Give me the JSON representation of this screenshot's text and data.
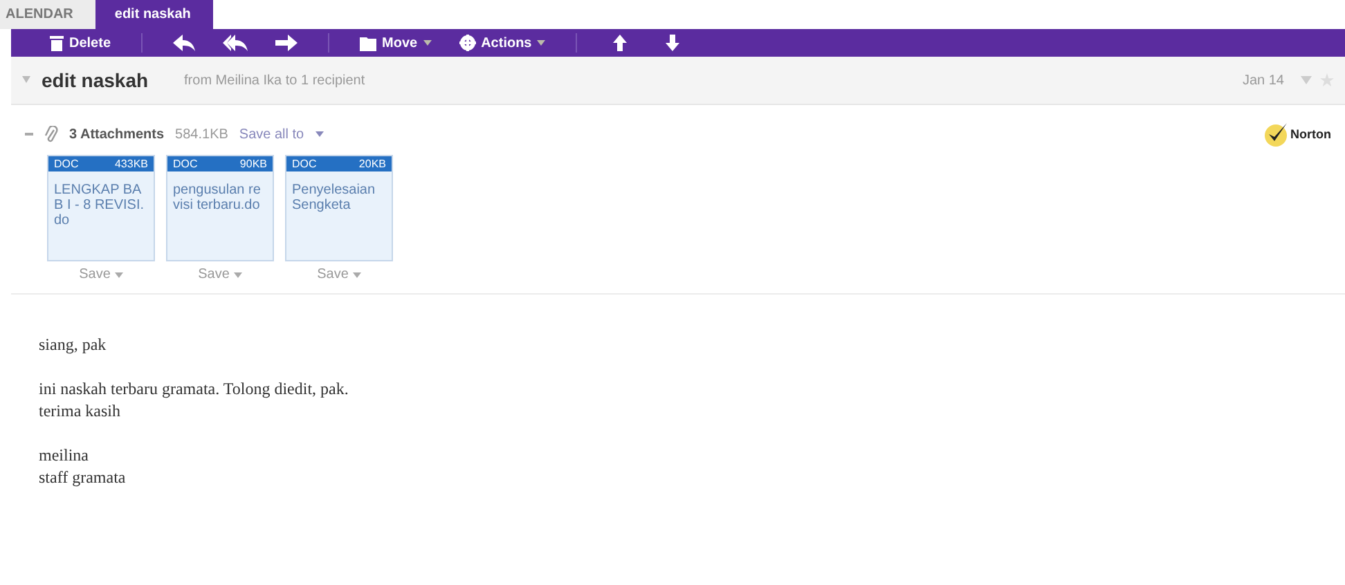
{
  "tabs": [
    {
      "label": "ALENDAR",
      "selected": false
    },
    {
      "label": "edit naskah",
      "selected": true
    }
  ],
  "toolbar": {
    "delete": "Delete",
    "move": "Move",
    "actions": "Actions"
  },
  "message": {
    "subject": "edit naskah",
    "from": "from Meilina Ika to 1 recipient",
    "date": "Jan 14"
  },
  "attachments": {
    "count": "3 Attachments",
    "size": "584.1KB",
    "save_all": "Save all to",
    "badge": "Norton",
    "files": [
      {
        "type": "DOC",
        "size": "433KB",
        "name": "LENGKAP BAB I - 8 REVISI.do",
        "save": "Save"
      },
      {
        "type": "DOC",
        "size": "90KB",
        "name": "pengusulan revisi terbaru.do",
        "save": "Save"
      },
      {
        "type": "DOC",
        "size": "20KB",
        "name": "Penyelesaian Sengketa",
        "save": "Save"
      }
    ]
  },
  "body": [
    [
      "siang, pak"
    ],
    [
      "ini naskah terbaru gramata. Tolong diedit, pak.",
      "terima kasih"
    ],
    [
      "meilina",
      "staff gramata"
    ]
  ]
}
